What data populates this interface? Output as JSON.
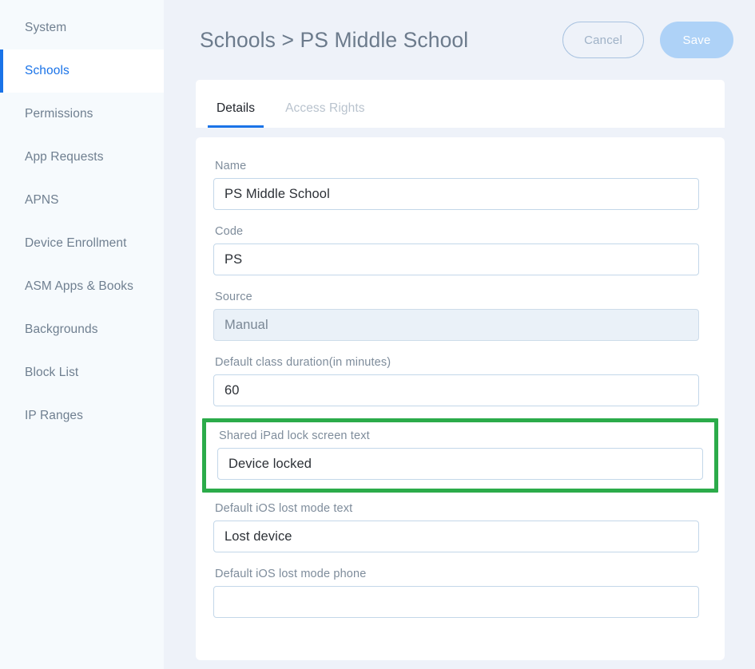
{
  "sidebar": {
    "items": [
      {
        "label": "System",
        "active": false
      },
      {
        "label": "Schools",
        "active": true
      },
      {
        "label": "Permissions",
        "active": false
      },
      {
        "label": "App Requests",
        "active": false
      },
      {
        "label": "APNS",
        "active": false
      },
      {
        "label": "Device Enrollment",
        "active": false
      },
      {
        "label": "ASM Apps & Books",
        "active": false
      },
      {
        "label": "Backgrounds",
        "active": false
      },
      {
        "label": "Block List",
        "active": false
      },
      {
        "label": "IP Ranges",
        "active": false
      }
    ]
  },
  "header": {
    "title": "Schools > PS Middle School",
    "cancel_label": "Cancel",
    "save_label": "Save"
  },
  "tabs": [
    {
      "label": "Details",
      "active": true
    },
    {
      "label": "Access Rights",
      "active": false
    }
  ],
  "form": {
    "fields": [
      {
        "label": "Name",
        "value": "PS Middle School",
        "placeholder": "",
        "disabled": false,
        "highlighted": false
      },
      {
        "label": "Code",
        "value": "PS",
        "placeholder": "",
        "disabled": false,
        "highlighted": false
      },
      {
        "label": "Source",
        "value": "Manual",
        "placeholder": "",
        "disabled": true,
        "highlighted": false
      },
      {
        "label": "Default class duration(in minutes)",
        "value": "60",
        "placeholder": "",
        "disabled": false,
        "highlighted": false
      },
      {
        "label": "Shared iPad lock screen text",
        "value": "Device locked",
        "placeholder": "",
        "disabled": false,
        "highlighted": true
      },
      {
        "label": "Default iOS lost mode text",
        "value": "Lost device",
        "placeholder": "",
        "disabled": false,
        "highlighted": false
      },
      {
        "label": "Default iOS lost mode phone",
        "value": "",
        "placeholder": "",
        "disabled": false,
        "highlighted": false
      }
    ]
  },
  "colors": {
    "accent_blue": "#1a73e8",
    "highlight_green": "#2bab4a",
    "save_button": "#aed2f7",
    "page_background": "#eef2f9",
    "sidebar_background": "#f6fafd"
  }
}
